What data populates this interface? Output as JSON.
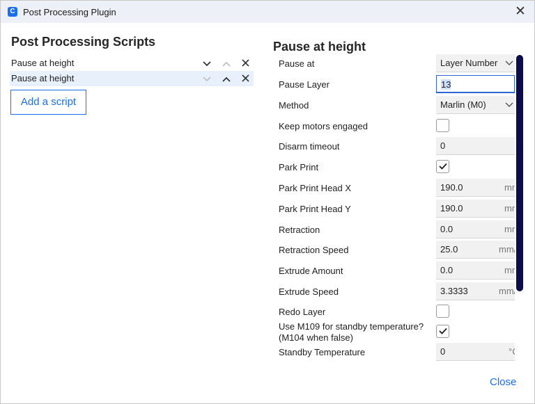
{
  "window": {
    "title": "Post Processing Plugin",
    "app_icon_glyph": "C",
    "close_glyph": "✕"
  },
  "scripts_panel": {
    "heading": "Post Processing Scripts",
    "scripts": [
      {
        "name": "Pause at height",
        "selected": false,
        "move_down_enabled": true,
        "move_up_enabled": false
      },
      {
        "name": "Pause at height",
        "selected": true,
        "move_down_enabled": false,
        "move_up_enabled": true
      }
    ],
    "add_button_label": "Add a script"
  },
  "settings_panel": {
    "heading": "Pause at height",
    "settings": [
      {
        "label": "Pause at",
        "type": "dropdown",
        "value": "Layer Number"
      },
      {
        "label": "Pause Layer",
        "type": "text",
        "value": "13",
        "focused": true
      },
      {
        "label": "Method",
        "type": "dropdown",
        "value": "Marlin (M0)"
      },
      {
        "label": "Keep motors engaged",
        "type": "checkbox",
        "checked": false
      },
      {
        "label": "Disarm timeout",
        "type": "text",
        "value": "0"
      },
      {
        "label": "Park Print",
        "type": "checkbox",
        "checked": true
      },
      {
        "label": "Park Print Head X",
        "type": "text",
        "value": "190.0",
        "unit": "mm"
      },
      {
        "label": "Park Print Head Y",
        "type": "text",
        "value": "190.0",
        "unit": "mm"
      },
      {
        "label": "Retraction",
        "type": "text",
        "value": "0.0",
        "unit": "mm"
      },
      {
        "label": "Retraction Speed",
        "type": "text",
        "value": "25.0",
        "unit": "mm/s"
      },
      {
        "label": "Extrude Amount",
        "type": "text",
        "value": "0.0",
        "unit": "mm"
      },
      {
        "label": "Extrude Speed",
        "type": "text",
        "value": "3.3333",
        "unit": "mm/s"
      },
      {
        "label": "Redo Layer",
        "type": "checkbox",
        "checked": false
      },
      {
        "label": "Use M109 for standby temperature?",
        "label2": "(M104 when false)",
        "type": "checkbox",
        "checked": true
      },
      {
        "label": "Standby Temperature",
        "type": "text",
        "value": "0",
        "unit": "°C"
      }
    ]
  },
  "footer": {
    "close_label": "Close"
  },
  "colors": {
    "accent": "#196ef0",
    "scrollbar": "#0d0d4e",
    "selected_row": "#e8f0fc"
  }
}
